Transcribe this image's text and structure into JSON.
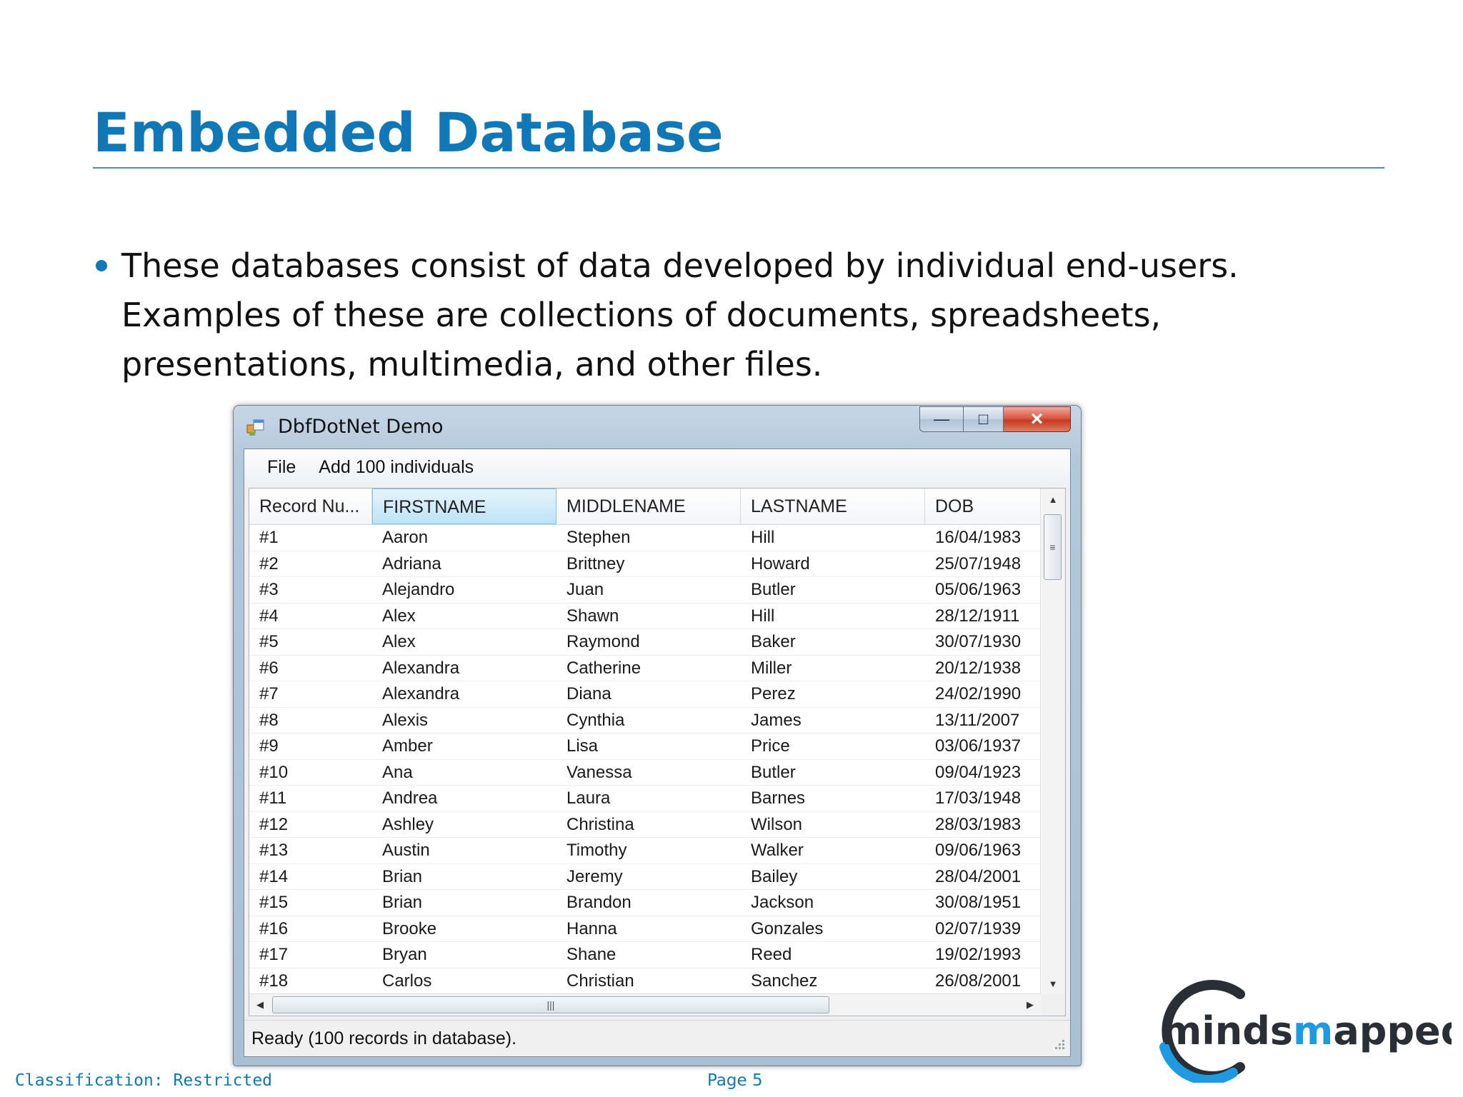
{
  "slide": {
    "title": "Embedded Database",
    "bullet": "These databases consist of data developed by individual end-users. Examples of these are collections of documents, spreadsheets, presentations, multimedia, and other files."
  },
  "window": {
    "title": "DbfDotNet Demo",
    "caption_min": "—",
    "caption_max": "□",
    "caption_close": "×",
    "menu": [
      "File",
      "Add 100 individuals"
    ],
    "columns": [
      "Record Nu...",
      "FIRSTNAME",
      "MIDDLENAME",
      "LASTNAME",
      "DOB"
    ],
    "selected_column": "FIRSTNAME",
    "rows": [
      [
        "#1",
        "Aaron",
        "Stephen",
        "Hill",
        "16/04/1983"
      ],
      [
        "#2",
        "Adriana",
        "Brittney",
        "Howard",
        "25/07/1948"
      ],
      [
        "#3",
        "Alejandro",
        "Juan",
        "Butler",
        "05/06/1963"
      ],
      [
        "#4",
        "Alex",
        "Shawn",
        "Hill",
        "28/12/1911"
      ],
      [
        "#5",
        "Alex",
        "Raymond",
        "Baker",
        "30/07/1930"
      ],
      [
        "#6",
        "Alexandra",
        "Catherine",
        "Miller",
        "20/12/1938"
      ],
      [
        "#7",
        "Alexandra",
        "Diana",
        "Perez",
        "24/02/1990"
      ],
      [
        "#8",
        "Alexis",
        "Cynthia",
        "James",
        "13/11/2007"
      ],
      [
        "#9",
        "Amber",
        "Lisa",
        "Price",
        "03/06/1937"
      ],
      [
        "#10",
        "Ana",
        "Vanessa",
        "Butler",
        "09/04/1923"
      ],
      [
        "#11",
        "Andrea",
        "Laura",
        "Barnes",
        "17/03/1948"
      ],
      [
        "#12",
        "Ashley",
        "Christina",
        "Wilson",
        "28/03/1983"
      ],
      [
        "#13",
        "Austin",
        "Timothy",
        "Walker",
        "09/06/1963"
      ],
      [
        "#14",
        "Brian",
        "Jeremy",
        "Bailey",
        "28/04/2001"
      ],
      [
        "#15",
        "Brian",
        "Brandon",
        "Jackson",
        "30/08/1951"
      ],
      [
        "#16",
        "Brooke",
        "Hanna",
        "Gonzales",
        "02/07/1939"
      ],
      [
        "#17",
        "Bryan",
        "Shane",
        "Reed",
        "19/02/1993"
      ],
      [
        "#18",
        "Carlos",
        "Christian",
        "Sanchez",
        "26/08/2001"
      ]
    ],
    "status": "Ready (100 records in database)."
  },
  "footer": {
    "classification": "Classification: Restricted",
    "page": "Page 5"
  },
  "logo": {
    "text_part1": "minds",
    "text_part2": "m",
    "text_part3": "apped"
  },
  "colors": {
    "title_blue": "#1078b6",
    "logo_dark": "#2a2f36",
    "logo_blue": "#1e9be0"
  },
  "icons": {
    "app": "app-window-icon",
    "scroll_up": "arrow-up-icon",
    "scroll_down": "arrow-down-icon",
    "scroll_left": "arrow-left-icon",
    "scroll_right": "arrow-right-icon"
  }
}
